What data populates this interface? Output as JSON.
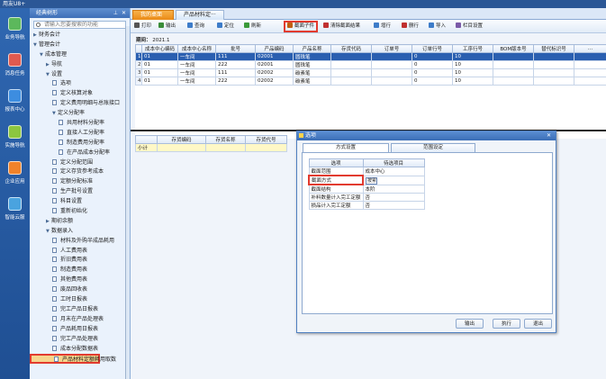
{
  "app": {
    "title": "用友U8+"
  },
  "leftnav": [
    {
      "label": "业务导航",
      "color": "#5cb85c"
    },
    {
      "label": "消息任务",
      "color": "#e05a4f"
    },
    {
      "label": "报表中心",
      "color": "#3d8de0"
    },
    {
      "label": "实施导航",
      "color": "#8cc63f"
    },
    {
      "label": "企业应用",
      "color": "#f0822a"
    },
    {
      "label": "智能云服",
      "color": "#4aa3df"
    }
  ],
  "tree": {
    "header": "经典树形",
    "search_placeholder": "请输入您要搜索的功能",
    "nodes": [
      {
        "label": "财务会计",
        "level": 0,
        "arrow": "▶"
      },
      {
        "label": "管理会计",
        "level": 0,
        "arrow": "▼"
      },
      {
        "label": "成本管理",
        "level": 1,
        "arrow": "▼"
      },
      {
        "label": "导航",
        "level": 2,
        "arrow": "▶"
      },
      {
        "label": "设置",
        "level": 2,
        "arrow": "▼"
      },
      {
        "label": "选项",
        "level": 3,
        "doc": true
      },
      {
        "label": "定义核算对象",
        "level": 3,
        "doc": true
      },
      {
        "label": "定义费用明细与总账接口",
        "level": 3,
        "doc": true
      },
      {
        "label": "定义分配率",
        "level": 3,
        "arrow": "▼"
      },
      {
        "label": "共用材料分配率",
        "level": 4,
        "doc": true
      },
      {
        "label": "直接人工分配率",
        "level": 4,
        "doc": true
      },
      {
        "label": "制造费用分配率",
        "level": 4,
        "doc": true
      },
      {
        "label": "在产品成本分配率",
        "level": 4,
        "doc": true
      },
      {
        "label": "定义分配范围",
        "level": 3,
        "doc": true
      },
      {
        "label": "定义存货参考成本",
        "level": 3,
        "doc": true
      },
      {
        "label": "定额分配标准",
        "level": 3,
        "doc": true
      },
      {
        "label": "生产批号设置",
        "level": 3,
        "doc": true
      },
      {
        "label": "科目设置",
        "level": 3,
        "doc": true
      },
      {
        "label": "重新初始化",
        "level": 3,
        "doc": true
      },
      {
        "label": "期初余额",
        "level": 2,
        "arrow": "▶"
      },
      {
        "label": "数据录入",
        "level": 2,
        "arrow": "▼"
      },
      {
        "label": "材料及外购半成品耗用",
        "level": 3,
        "doc": true
      },
      {
        "label": "人工费用表",
        "level": 3,
        "doc": true
      },
      {
        "label": "折旧费用表",
        "level": 3,
        "doc": true
      },
      {
        "label": "制造费用表",
        "level": 3,
        "doc": true
      },
      {
        "label": "其他费用表",
        "level": 3,
        "doc": true
      },
      {
        "label": "废品回收表",
        "level": 3,
        "doc": true
      },
      {
        "label": "工时日报表",
        "level": 3,
        "doc": true
      },
      {
        "label": "完工产品日报表",
        "level": 3,
        "doc": true
      },
      {
        "label": "月末在产品处理表",
        "level": 3,
        "doc": true
      },
      {
        "label": "产品耗用日报表",
        "level": 3,
        "doc": true
      },
      {
        "label": "完工产品处理表",
        "level": 3,
        "doc": true
      },
      {
        "label": "成本分配数据表",
        "level": 3,
        "doc": true
      },
      {
        "label": "产品材料定额耗用取数",
        "level": 3,
        "doc": true,
        "selected": true
      }
    ]
  },
  "tabs": [
    {
      "label": "我的桌面",
      "active": false
    },
    {
      "label": "产品材料定···",
      "active": true
    }
  ],
  "toolbar": [
    {
      "label": "打印",
      "icon": "print-icon",
      "color": "#555"
    },
    {
      "label": "输出",
      "icon": "export-icon",
      "color": "#3a8d3a"
    },
    {
      "label": "查询",
      "icon": "query-icon",
      "color": "#3d7cc9"
    },
    {
      "label": "定位",
      "icon": "locate-icon",
      "color": "#3d7cc9"
    },
    {
      "label": "刷新",
      "icon": "refresh-icon",
      "color": "#3a9a3a"
    },
    {
      "label": "截面子件",
      "icon": "section-icon",
      "color": "#c06010"
    },
    {
      "label": "清除截面结果",
      "icon": "clear-icon",
      "color": "#c03030"
    },
    {
      "label": "增行",
      "icon": "add-row-icon",
      "color": "#3d7cc9"
    },
    {
      "label": "删行",
      "icon": "delete-row-icon",
      "color": "#c03030"
    },
    {
      "label": "导入",
      "icon": "import-icon",
      "color": "#3d7cc9"
    },
    {
      "label": "栏目设置",
      "icon": "column-settings-icon",
      "color": "#7a5aa8"
    }
  ],
  "period": {
    "label": "期间：",
    "value": "2021.1"
  },
  "main_table": {
    "columns": [
      "成本中心编码",
      "成本中心名称",
      "批号",
      "产品编码",
      "产品名称",
      "存货代码",
      "订单号",
      "订单行号",
      "工序行号",
      "BOM版本号",
      "替代标识号",
      "..."
    ],
    "rows": [
      {
        "no": "1",
        "cells": [
          "01",
          "一车间",
          "111",
          "02001",
          "圆珠笔",
          "",
          "",
          "0",
          "10",
          "",
          "",
          ""
        ]
      },
      {
        "no": "2",
        "cells": [
          "01",
          "一车间",
          "222",
          "02001",
          "圆珠笔",
          "",
          "",
          "0",
          "10",
          "",
          "",
          ""
        ]
      },
      {
        "no": "3",
        "cells": [
          "01",
          "一车间",
          "111",
          "02002",
          "碳素笔",
          "",
          "",
          "0",
          "10",
          "",
          "",
          ""
        ]
      },
      {
        "no": "4",
        "cells": [
          "01",
          "一车间",
          "222",
          "02002",
          "碳素笔",
          "",
          "",
          "0",
          "10",
          "",
          "",
          ""
        ]
      }
    ]
  },
  "sub_table": {
    "columns": [
      "存货编码",
      "存货名称",
      "存货代号"
    ],
    "subtotal_label": "小计"
  },
  "dialog": {
    "title": "选项",
    "tabs": [
      "方式设置",
      "范围设定"
    ],
    "option_headers": [
      "选项",
      "待选项目"
    ],
    "options": [
      {
        "name": "截面范围",
        "value": "成本中心"
      },
      {
        "name": "截面方式",
        "value": "按累"
      },
      {
        "name": "截面结构",
        "value": "本阶"
      },
      {
        "name": "补料数量计入完工定额",
        "value": "否"
      },
      {
        "name": "损品计入完工定额",
        "value": "否"
      }
    ],
    "buttons": {
      "export": "输出",
      "execute": "执行",
      "exit": "退出"
    }
  }
}
